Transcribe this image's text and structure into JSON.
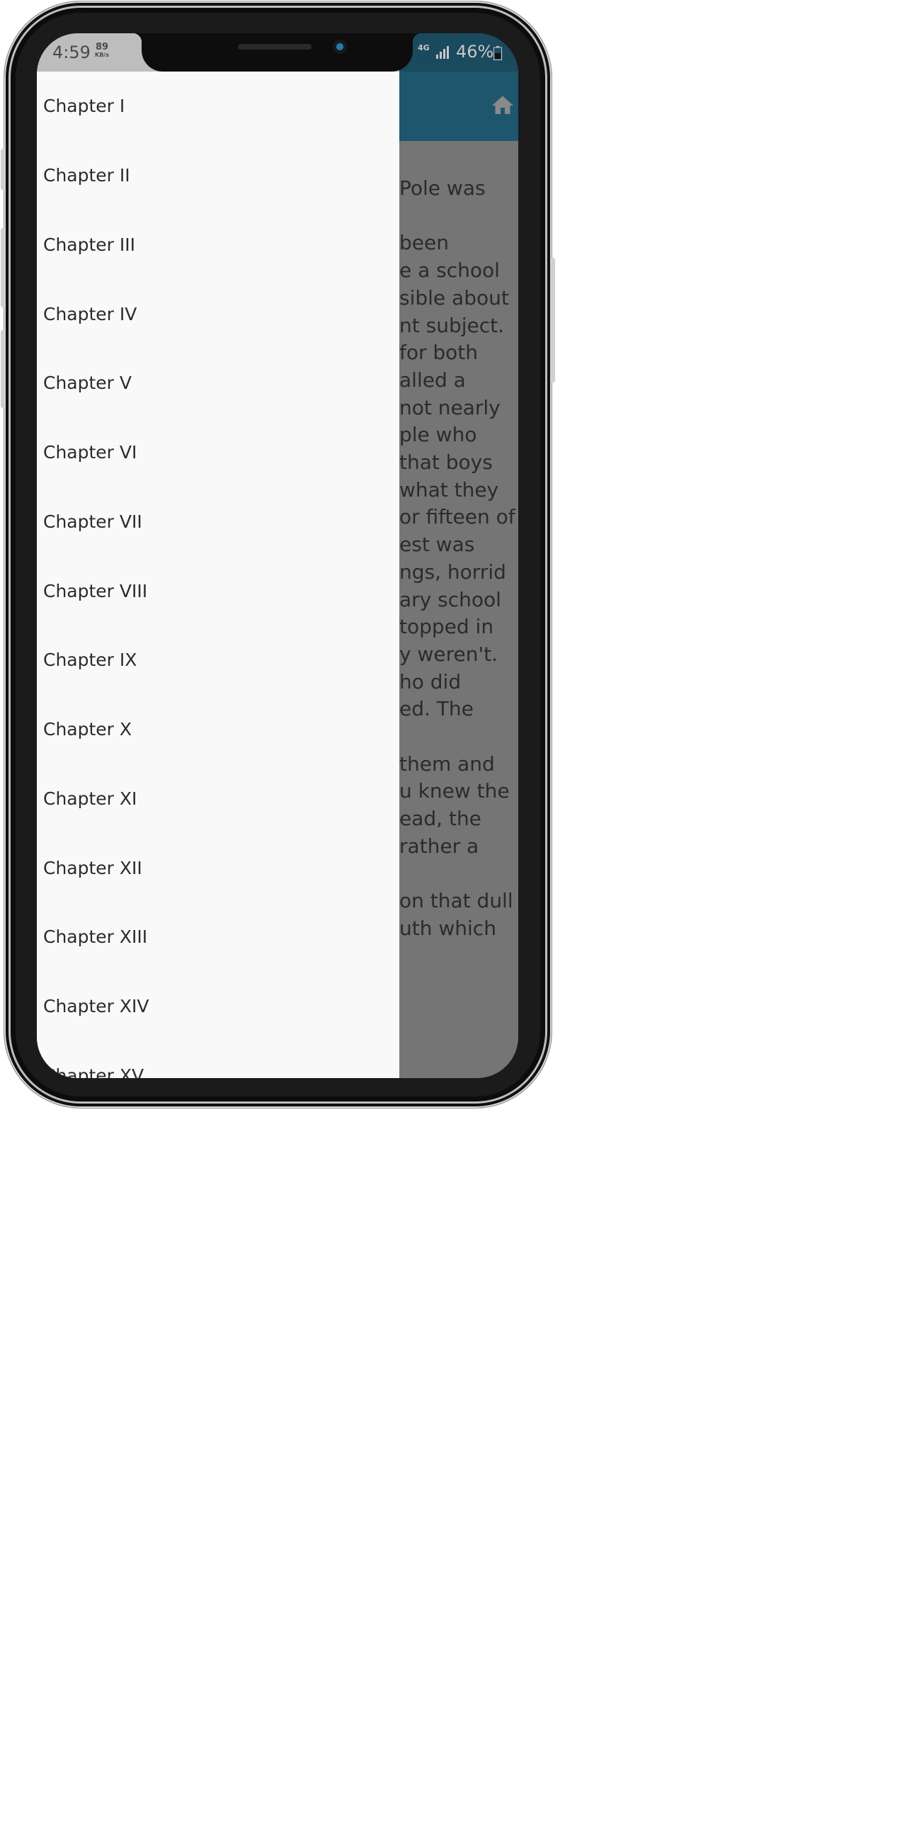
{
  "status_bar": {
    "time": "4:59",
    "net_speed_value": "89",
    "net_speed_unit": "KB/s",
    "network_type": "4G",
    "battery_percent": "46%"
  },
  "app_bar": {
    "home_icon": "home-icon"
  },
  "drawer": {
    "items": [
      {
        "label": "Chapter I"
      },
      {
        "label": "Chapter II"
      },
      {
        "label": "Chapter III"
      },
      {
        "label": "Chapter IV"
      },
      {
        "label": "Chapter V"
      },
      {
        "label": "Chapter VI"
      },
      {
        "label": "Chapter VII"
      },
      {
        "label": "Chapter VIII"
      },
      {
        "label": "Chapter IX"
      },
      {
        "label": "Chapter X"
      },
      {
        "label": "Chapter XI"
      },
      {
        "label": "Chapter XII"
      },
      {
        "label": "Chapter XIII"
      },
      {
        "label": "Chapter XIV"
      },
      {
        "label": "Chapter XV"
      }
    ]
  },
  "content": {
    "lines": [
      "Pole was",
      "",
      " been",
      "e a school",
      "sible about",
      "nt subject.",
      "for both",
      "alled a",
      "not nearly",
      "ple who",
      "that boys",
      "what they",
      "or fifteen of",
      "est was",
      "ngs, horrid",
      "ary school",
      "topped in",
      "y weren't.",
      "ho did",
      "ed. The",
      "",
      "them and",
      "u knew the",
      "ead, the",
      " rather a",
      "",
      "on that dull",
      "uth which"
    ]
  },
  "colors": {
    "app_bar": "#1d566d",
    "drawer_bg": "#f9f9f9",
    "scrim": "#757575"
  }
}
